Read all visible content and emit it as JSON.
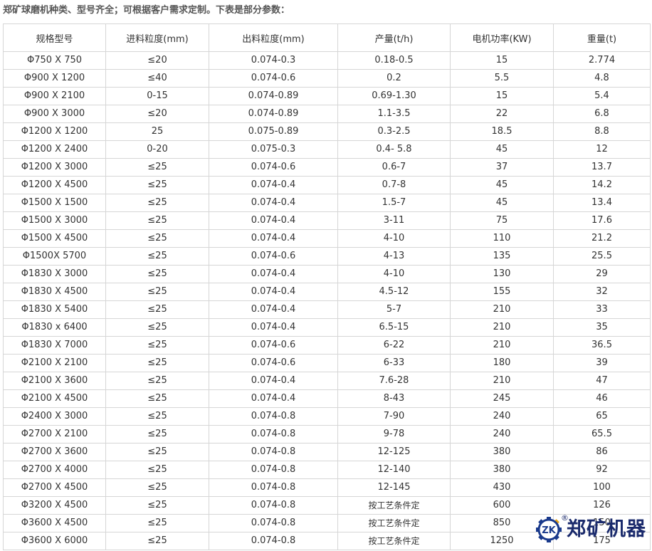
{
  "intro": "郑矿球磨机种类、型号齐全；可根据客户需求定制。下表是部分参数：",
  "table": {
    "headers": [
      "规格型号",
      "进料粒度(mm)",
      "出料粒度(mm)",
      "产量(t/h)",
      "电机功率(KW)",
      "重量(t)"
    ],
    "rows": [
      [
        "Φ750 X 750",
        "≤20",
        "0.074-0.3",
        "0.18-0.5",
        "15",
        "2.774"
      ],
      [
        "Φ900 X 1200",
        "≤40",
        "0.074-0.6",
        "0.2",
        "5.5",
        "4.8"
      ],
      [
        "Φ900 X 2100",
        "0-15",
        "0.074-0.89",
        "0.69-1.30",
        "15",
        "5.4"
      ],
      [
        "Φ900 X 3000",
        "≤20",
        "0.074-0.89",
        "1.1-3.5",
        "22",
        "6.8"
      ],
      [
        "Φ1200 X 1200",
        "25",
        "0.075-0.89",
        "0.3-2.5",
        "18.5",
        "8.8"
      ],
      [
        "Φ1200 X 2400",
        "0-20",
        "0.075-0.3",
        "0.4- 5.8",
        "45",
        "12"
      ],
      [
        "Φ1200 X 3000",
        "≤25",
        "0.074-0.6",
        "0.6-7",
        "37",
        "13.7"
      ],
      [
        "Φ1200 X 4500",
        "≤25",
        "0.074-0.4",
        "0.7-8",
        "45",
        "14.2"
      ],
      [
        "Φ1500 X 1500",
        "≤25",
        "0.074-0.4",
        "1.5-7",
        "45",
        "13.4"
      ],
      [
        "Φ1500 X 3000",
        "≤25",
        "0.074-0.4",
        "3-11",
        "75",
        "17.6"
      ],
      [
        "Φ1500 X 4500",
        "≤25",
        "0.074-0.4",
        "4-10",
        "110",
        "21.2"
      ],
      [
        "Φ1500X 5700",
        "≤25",
        "0.074-0.6",
        "4-13",
        "135",
        "25.5"
      ],
      [
        "Φ1830 X 3000",
        "≤25",
        "0.074-0.4",
        "4-10",
        "130",
        "29"
      ],
      [
        "Φ1830 X 4500",
        "≤25",
        "0.074-0.4",
        "4.5-12",
        "155",
        "32"
      ],
      [
        "Φ1830 X 5400",
        "≤25",
        "0.074-0.4",
        "5-7",
        "210",
        "33"
      ],
      [
        "Φ1830 x 6400",
        "≤25",
        "0.074-0.4",
        "6.5-15",
        "210",
        "35"
      ],
      [
        "Φ1830 X 7000",
        "≤25",
        "0.074-0.6",
        "6-22",
        "210",
        "36.5"
      ],
      [
        "Φ2100 X 2100",
        "≤25",
        "0.074-0.6",
        "6-33",
        "180",
        "39"
      ],
      [
        "Φ2100 X 3600",
        "≤25",
        "0.074-0.4",
        "7.6-28",
        "210",
        "47"
      ],
      [
        "Φ2100 X 4500",
        "≤25",
        "0.074-0.4",
        "8-43",
        "245",
        "46"
      ],
      [
        "Φ2400 X 3000",
        "≤25",
        "0.074-0.8",
        "7-90",
        "240",
        "65"
      ],
      [
        "Φ2700 X 2100",
        "≤25",
        "0.074-0.8",
        "9-78",
        "240",
        "65.5"
      ],
      [
        "Φ2700 X 3600",
        "≤25",
        "0.074-0.8",
        "12-125",
        "380",
        "86"
      ],
      [
        "Φ2700 X 4000",
        "≤25",
        "0.074-0.8",
        "12-140",
        "380",
        "92"
      ],
      [
        "Φ2700 X 4500",
        "≤25",
        "0.074-0.8",
        "12-145",
        "430",
        "100"
      ],
      [
        "Φ3200 X 4500",
        "≤25",
        "0.074-0.8",
        "按工艺条件定",
        "600",
        "126"
      ],
      [
        "Φ3600 X 4500",
        "≤25",
        "0.074-0.8",
        "按工艺条件定",
        "850",
        "150"
      ],
      [
        "Φ3600 X 6000",
        "≤25",
        "0.074-0.8",
        "按工艺条件定",
        "1250",
        "175"
      ]
    ]
  },
  "watermark": {
    "text": "郑矿机器",
    "mark_text": "ZK",
    "registered": "®",
    "colors": {
      "ring": "#1a3a8c",
      "accent": "#e8a317",
      "text": "#1a2a6c"
    }
  }
}
